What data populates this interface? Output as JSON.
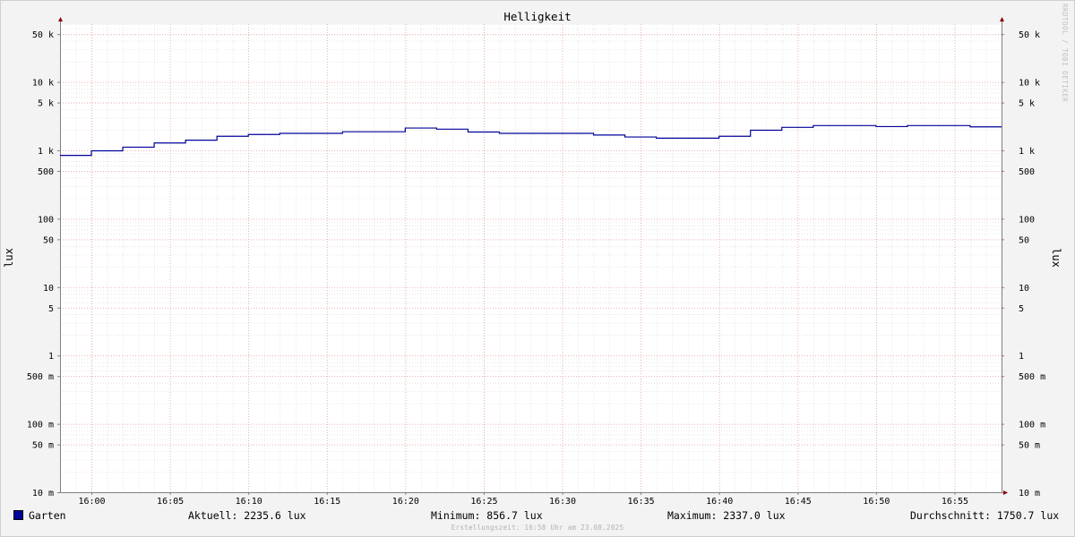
{
  "watermark": "RRDTOOL / TOBI OETIKER",
  "footer": "Erstellungszeit: 16:58 Uhr am 23.08.2025",
  "legend": {
    "series_name": "Garten",
    "current": "Aktuell: 2235.6 lux",
    "minimum": "Minimum: 856.7 lux",
    "maximum": "Maximum: 2337.0 lux",
    "average": "Durchschnitt: 1750.7 lux"
  },
  "colors": {
    "series": "#00009b",
    "major_grid": "#e8a0a0",
    "minor_grid": "#d8d8d8",
    "axis": "#808080",
    "canvas": "#ffffff",
    "background": "#f3f3f3"
  },
  "chart_data": {
    "type": "line",
    "step": true,
    "title": "Helligkeit",
    "ylabel": "lux",
    "ylabel_right": "lux",
    "yscale": "log",
    "ylim": [
      0.01,
      70000
    ],
    "x_unit": "time (HH:MM)",
    "xlim": [
      "15:58",
      "16:58"
    ],
    "x_ticks": [
      "16:00",
      "16:05",
      "16:10",
      "16:15",
      "16:20",
      "16:25",
      "16:30",
      "16:35",
      "16:40",
      "16:45",
      "16:50",
      "16:55"
    ],
    "y_ticks": [
      {
        "value": 50000,
        "label": "50 k"
      },
      {
        "value": 10000,
        "label": "10 k"
      },
      {
        "value": 5000,
        "label": "5 k"
      },
      {
        "value": 1000,
        "label": "1 k"
      },
      {
        "value": 500,
        "label": "500"
      },
      {
        "value": 100,
        "label": "100"
      },
      {
        "value": 50,
        "label": "50"
      },
      {
        "value": 10,
        "label": "10"
      },
      {
        "value": 5,
        "label": "5"
      },
      {
        "value": 1,
        "label": "1"
      },
      {
        "value": 0.5,
        "label": "500 m"
      },
      {
        "value": 0.1,
        "label": "100 m"
      },
      {
        "value": 0.05,
        "label": "50 m"
      },
      {
        "value": 0.01,
        "label": "10 m"
      }
    ],
    "grid": true,
    "legend_placement": "bottom",
    "series": [
      {
        "name": "Garten",
        "x": [
          "15:58",
          "16:00",
          "16:02",
          "16:04",
          "16:06",
          "16:08",
          "16:10",
          "16:12",
          "16:14",
          "16:16",
          "16:18",
          "16:20",
          "16:22",
          "16:24",
          "16:26",
          "16:28",
          "16:30",
          "16:32",
          "16:34",
          "16:36",
          "16:38",
          "16:40",
          "16:42",
          "16:44",
          "16:46",
          "16:48",
          "16:50",
          "16:52",
          "16:54",
          "16:56",
          "16:58"
        ],
        "values": [
          857,
          1000,
          1130,
          1300,
          1430,
          1630,
          1730,
          1800,
          1800,
          1900,
          1900,
          2150,
          2070,
          1880,
          1800,
          1800,
          1800,
          1700,
          1590,
          1530,
          1530,
          1630,
          2000,
          2200,
          2337,
          2337,
          2260,
          2337,
          2337,
          2236,
          2236
        ]
      }
    ]
  }
}
